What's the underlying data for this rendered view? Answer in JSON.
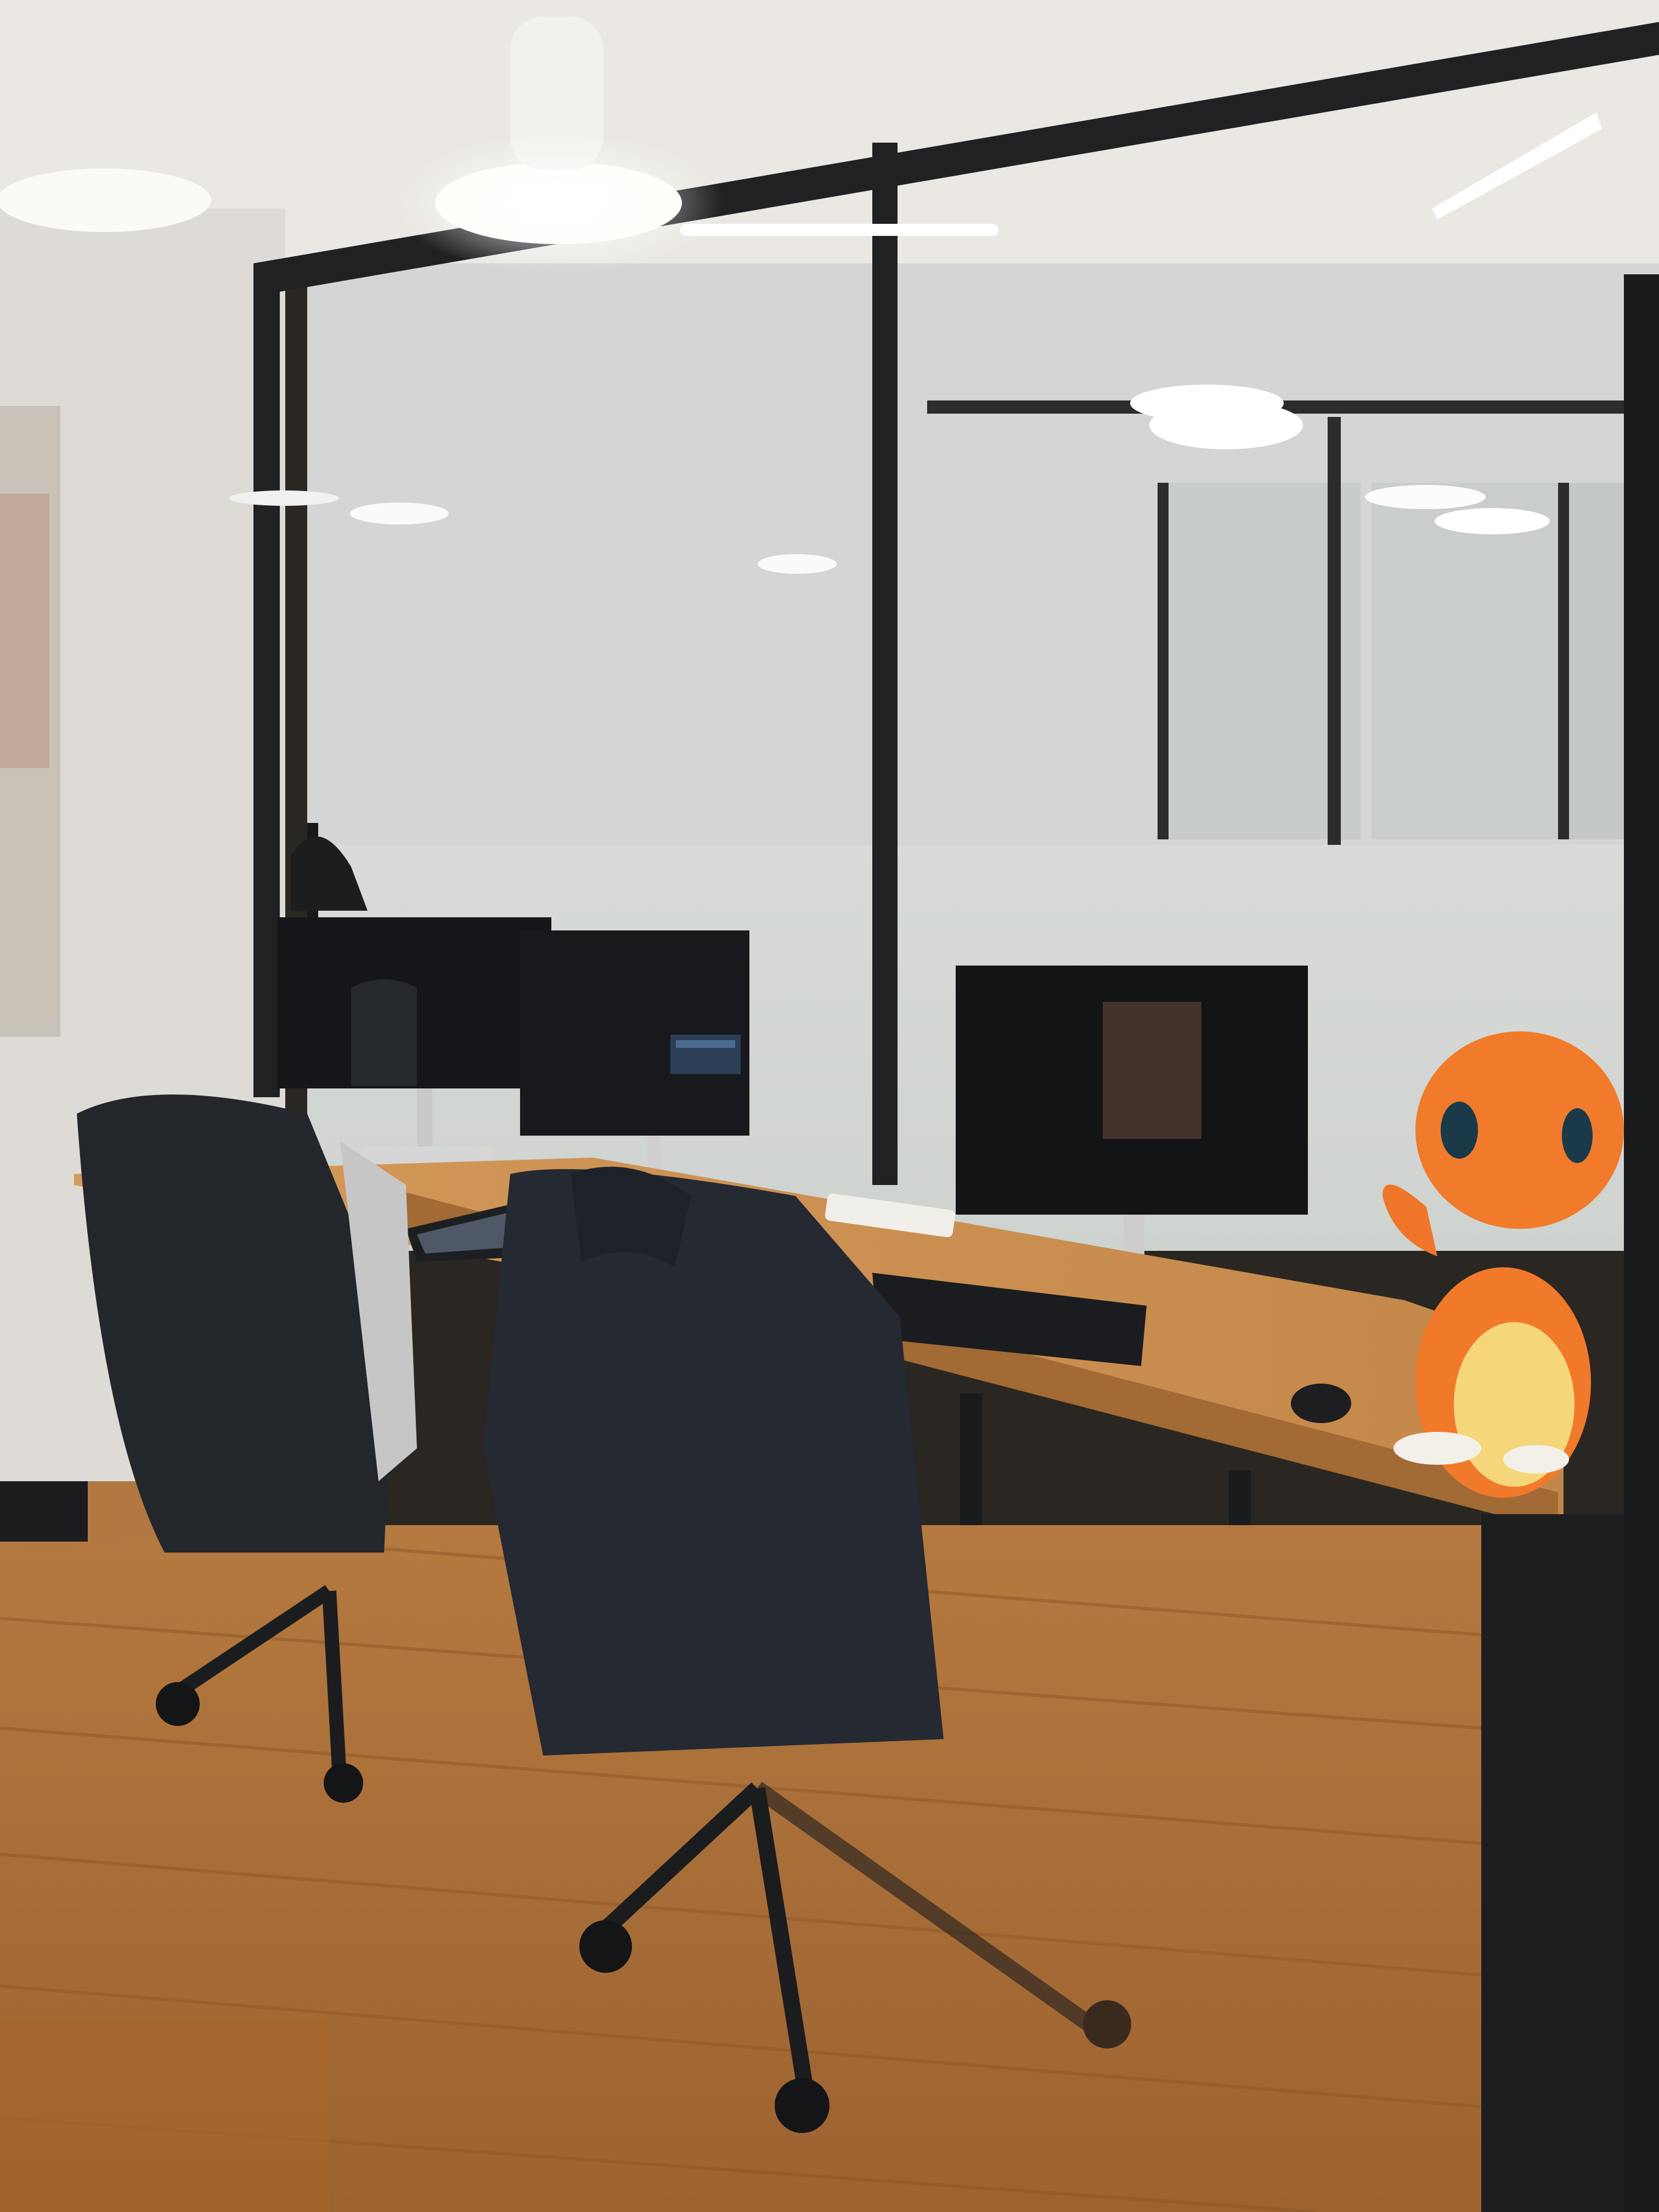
{
  "scene": {
    "description_label": "",
    "colors": {
      "ceiling": "#e9e6e2",
      "wall": "#e3e0dc",
      "frosted_glass": "#dcdfdd",
      "frame": "#1d1f21",
      "desk_top": "#c88c4c",
      "floor": "#b57a3c",
      "floor_dark": "#8a5526",
      "monitor": "#15171a",
      "jacket": "#262a30",
      "plush_orange": "#f07a2a",
      "plush_belly": "#f6d67a",
      "light": "#fffdf6"
    }
  }
}
